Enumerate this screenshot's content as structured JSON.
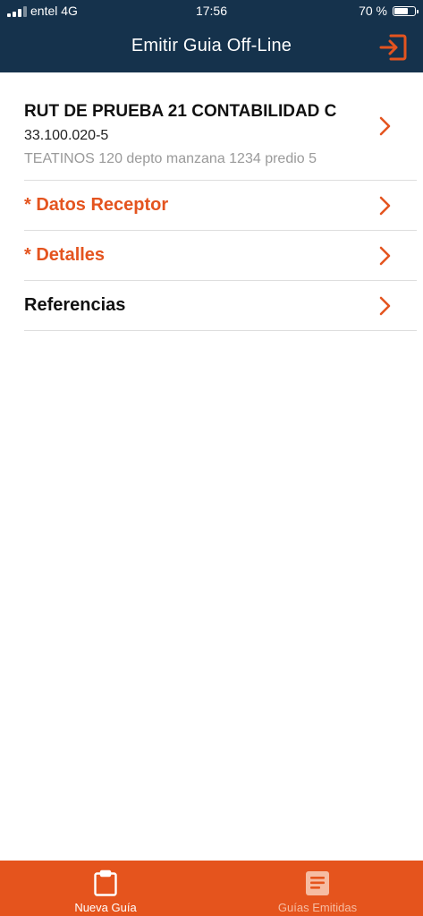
{
  "status_bar": {
    "carrier": "entel 4G",
    "time": "17:56",
    "battery_text": "70 %",
    "battery_level": 0.7
  },
  "header": {
    "title": "Emitir Guia Off-Line",
    "logout_icon": "sign-out-icon"
  },
  "issuer": {
    "name": "RUT DE PRUEBA 21 CONTABILIDAD C",
    "rut": "33.100.020-5",
    "address": "TEATINOS 120 depto manzana 1234 predio 5"
  },
  "menu": [
    {
      "label": "* Datos Receptor",
      "required": true
    },
    {
      "label": "* Detalles",
      "required": true
    },
    {
      "label": "Referencias",
      "required": false
    }
  ],
  "tabs": [
    {
      "label": "Nueva Guía",
      "icon": "clipboard-icon",
      "active": true
    },
    {
      "label": "Guías Emitidas",
      "icon": "document-list-icon",
      "active": false
    }
  ],
  "colors": {
    "header_bg": "#15324c",
    "accent": "#e4541f",
    "tabbar_bg": "#e5541d"
  }
}
